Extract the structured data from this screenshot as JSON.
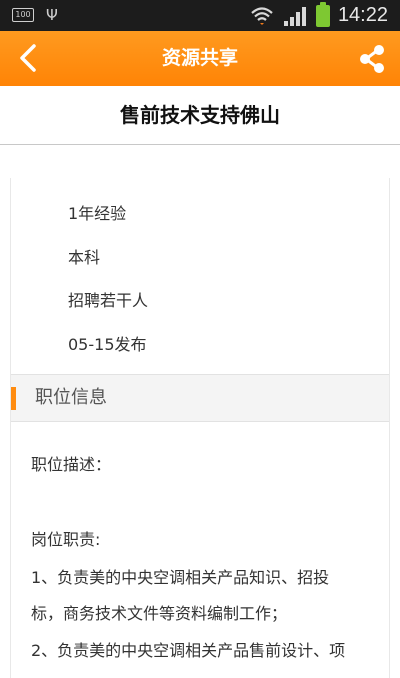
{
  "status_bar": {
    "battery_level": "100",
    "usb_icon": "usb-icon",
    "time": "14:22"
  },
  "header": {
    "title": "资源共享",
    "back_icon": "chevron-left-icon",
    "share_icon": "share-icon"
  },
  "job": {
    "title": "售前技术支持佛山"
  },
  "meta": {
    "experience": "1年经验",
    "education": "本科",
    "headcount": "招聘若干人",
    "posted": "05-15发布"
  },
  "section": {
    "title": "职位信息"
  },
  "description": {
    "label": "职位描述：",
    "duties_label": "岗位职责:",
    "line1": "1、负责美的中央空调相关产品知识、招投",
    "line2": "标，商务技术文件等资料编制工作；",
    "line3": "2、负责美的中央空调相关产品售前设计、项"
  },
  "colors": {
    "accent": "#ff8c10",
    "status_bar": "#1c1c1c",
    "battery": "#7ec832"
  }
}
